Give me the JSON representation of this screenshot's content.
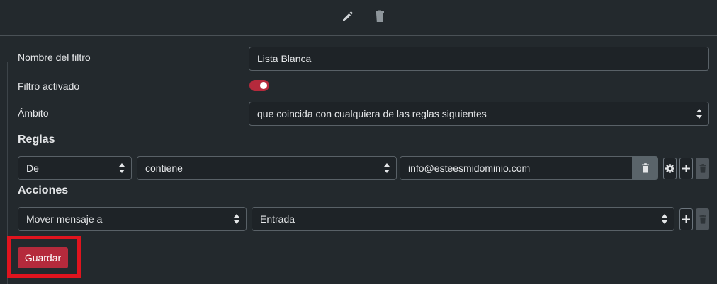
{
  "toolbar": {
    "edit_icon": "pencil-icon",
    "delete_icon": "trash-icon"
  },
  "form": {
    "name_label": "Nombre del filtro",
    "name_value": "Lista Blanca",
    "enabled_label": "Filtro activado",
    "enabled": true,
    "scope_label": "Ámbito",
    "scope_value": "que coincida con cualquiera de las reglas siguientes"
  },
  "rules": {
    "heading": "Reglas",
    "items": [
      {
        "field": "De",
        "operator": "contiene",
        "value": "info@esteesmidominio.com"
      }
    ]
  },
  "actions": {
    "heading": "Acciones",
    "items": [
      {
        "action": "Mover mensaje a",
        "target": "Entrada"
      }
    ]
  },
  "save_label": "Guardar",
  "colors": {
    "background": "#23292d",
    "accent": "#b52a3c",
    "highlight": "#e0141e"
  }
}
